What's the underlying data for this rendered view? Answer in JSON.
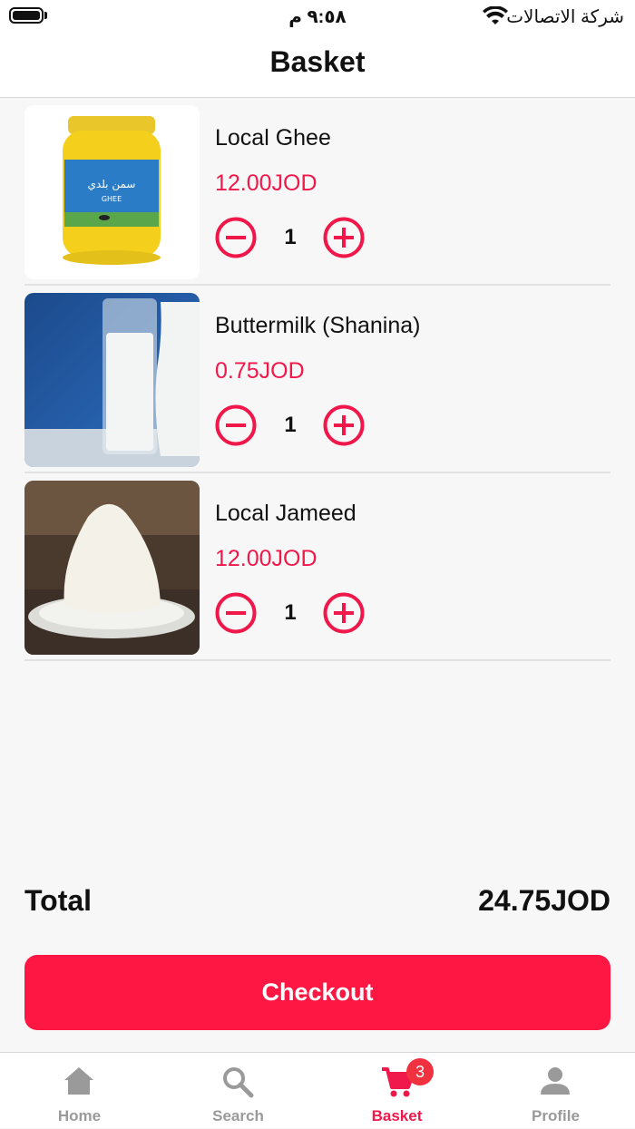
{
  "status_bar": {
    "time": "٩:٥٨ م",
    "carrier": "شركة الاتصالات"
  },
  "header": {
    "title": "Basket"
  },
  "items": [
    {
      "name": "Local Ghee",
      "price": "12.00JOD",
      "quantity": "1"
    },
    {
      "name": "Buttermilk (Shanina)",
      "price": "0.75JOD",
      "quantity": "1"
    },
    {
      "name": "Local Jameed",
      "price": "12.00JOD",
      "quantity": "1"
    }
  ],
  "ghee_label": {
    "arabic": "سمن بلدي",
    "english": "GHEE"
  },
  "total": {
    "label": "Total",
    "value": "24.75JOD"
  },
  "checkout_label": "Checkout",
  "tabbar": {
    "tabs": [
      {
        "label": "Home",
        "icon": "home-icon"
      },
      {
        "label": "Search",
        "icon": "search-icon"
      },
      {
        "label": "Basket",
        "icon": "cart-icon",
        "badge": "3",
        "active": true
      },
      {
        "label": "Profile",
        "icon": "person-icon"
      }
    ]
  },
  "colors": {
    "accent": "#f0184a",
    "checkout": "#ff1744",
    "inactive": "#9a9a9a"
  }
}
